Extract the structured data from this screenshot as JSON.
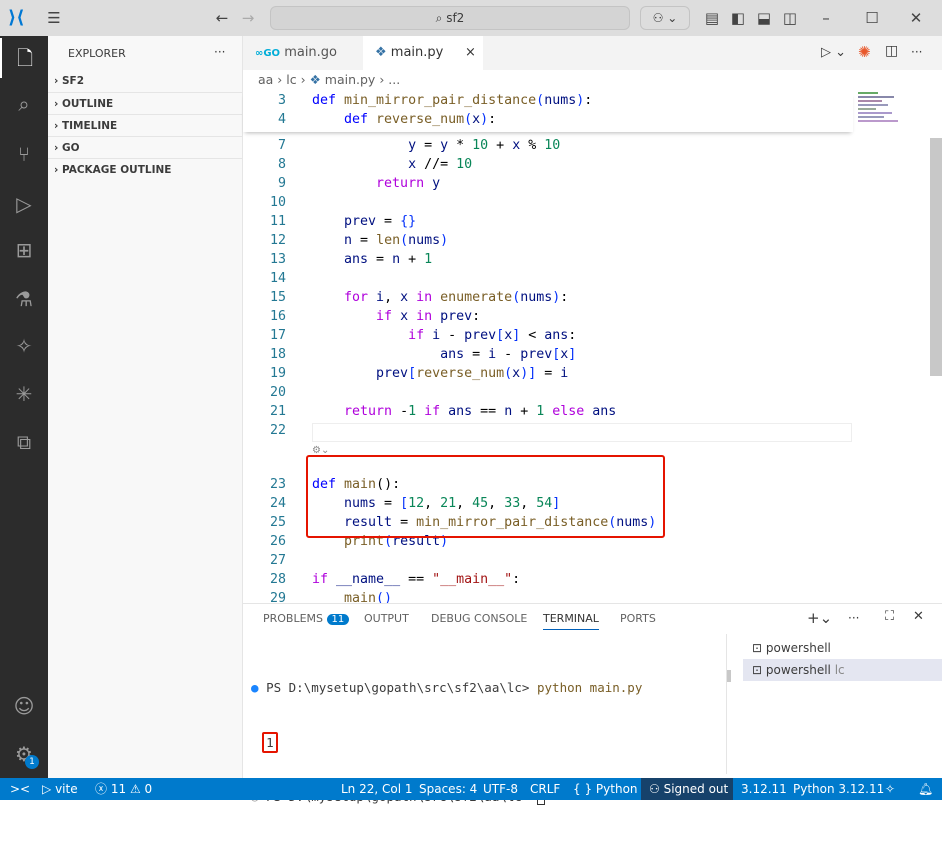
{
  "titlebar": {
    "search": "sf2",
    "back": "←",
    "forward": "→"
  },
  "activity": [
    "files-icon",
    "search-icon",
    "source-control-icon",
    "run-debug-icon",
    "extensions-icon",
    "testing-icon",
    "remote-icon",
    "copilot-icon",
    "remote-explorer-icon"
  ],
  "sidebar": {
    "title": "EXPLORER",
    "more": "···",
    "sections": [
      "SF2",
      "OUTLINE",
      "TIMELINE",
      "GO",
      "PACKAGE OUTLINE"
    ]
  },
  "tabs": [
    {
      "label": "main.go",
      "icon": "GO",
      "active": false
    },
    {
      "label": "main.py",
      "active": true,
      "close": "×"
    }
  ],
  "breadcrumb": [
    "aa",
    "lc",
    "main.py",
    "..."
  ],
  "sticky": [
    {
      "n": "3",
      "t": [
        [
          "def ",
          "k"
        ],
        [
          "min_mirror_pair_distance",
          "f"
        ],
        [
          "(",
          "b"
        ],
        [
          "nums",
          "v"
        ],
        [
          ")",
          "b"
        ],
        [
          ":",
          "p"
        ]
      ]
    },
    {
      "n": "4",
      "t": [
        [
          "    def ",
          "k"
        ],
        [
          "reverse_num",
          "f"
        ],
        [
          "(",
          "b"
        ],
        [
          "x",
          "v"
        ],
        [
          ")",
          "b"
        ],
        [
          ":",
          "p"
        ]
      ]
    }
  ],
  "lines": [
    {
      "n": "7",
      "t": [
        [
          "            y",
          "v"
        ],
        [
          " = ",
          "p"
        ],
        [
          "y",
          "v"
        ],
        [
          " * ",
          "p"
        ],
        [
          "10",
          "n"
        ],
        [
          " + ",
          "p"
        ],
        [
          "x",
          "v"
        ],
        [
          " % ",
          "p"
        ],
        [
          "10",
          "n"
        ]
      ]
    },
    {
      "n": "8",
      "t": [
        [
          "            x",
          "v"
        ],
        [
          " //= ",
          "p"
        ],
        [
          "10",
          "n"
        ]
      ]
    },
    {
      "n": "9",
      "t": [
        [
          "        return ",
          "c"
        ],
        [
          "y",
          "v"
        ]
      ]
    },
    {
      "n": "10",
      "t": []
    },
    {
      "n": "11",
      "t": [
        [
          "    prev",
          "v"
        ],
        [
          " = ",
          "p"
        ],
        [
          "{}",
          "b"
        ]
      ]
    },
    {
      "n": "12",
      "t": [
        [
          "    n",
          "v"
        ],
        [
          " = ",
          "p"
        ],
        [
          "len",
          "f"
        ],
        [
          "(",
          "b"
        ],
        [
          "nums",
          "v"
        ],
        [
          ")",
          "b"
        ]
      ]
    },
    {
      "n": "13",
      "t": [
        [
          "    ans",
          "v"
        ],
        [
          " = ",
          "p"
        ],
        [
          "n",
          "v"
        ],
        [
          " + ",
          "p"
        ],
        [
          "1",
          "n"
        ]
      ]
    },
    {
      "n": "14",
      "t": []
    },
    {
      "n": "15",
      "t": [
        [
          "    for ",
          "c"
        ],
        [
          "i",
          "v"
        ],
        [
          ", ",
          "p"
        ],
        [
          "x",
          "v"
        ],
        [
          " in ",
          "c"
        ],
        [
          "enumerate",
          "f"
        ],
        [
          "(",
          "b"
        ],
        [
          "nums",
          "v"
        ],
        [
          ")",
          "b"
        ],
        [
          ":",
          "p"
        ]
      ]
    },
    {
      "n": "16",
      "t": [
        [
          "        if ",
          "c"
        ],
        [
          "x",
          "v"
        ],
        [
          " in ",
          "c"
        ],
        [
          "prev",
          "v"
        ],
        [
          ":",
          "p"
        ]
      ]
    },
    {
      "n": "17",
      "t": [
        [
          "            if ",
          "c"
        ],
        [
          "i",
          "v"
        ],
        [
          " - ",
          "p"
        ],
        [
          "prev",
          "v"
        ],
        [
          "[",
          "b"
        ],
        [
          "x",
          "v"
        ],
        [
          "]",
          "b"
        ],
        [
          " < ",
          "p"
        ],
        [
          "ans",
          "v"
        ],
        [
          ":",
          "p"
        ]
      ]
    },
    {
      "n": "18",
      "t": [
        [
          "                ans",
          "v"
        ],
        [
          " = ",
          "p"
        ],
        [
          "i",
          "v"
        ],
        [
          " - ",
          "p"
        ],
        [
          "prev",
          "v"
        ],
        [
          "[",
          "b"
        ],
        [
          "x",
          "v"
        ],
        [
          "]",
          "b"
        ]
      ]
    },
    {
      "n": "19",
      "t": [
        [
          "        prev",
          "v"
        ],
        [
          "[",
          "b"
        ],
        [
          "reverse_num",
          "f"
        ],
        [
          "(",
          "b"
        ],
        [
          "x",
          "v"
        ],
        [
          ")",
          "b"
        ],
        [
          "]",
          "b"
        ],
        [
          " = ",
          "p"
        ],
        [
          "i",
          "v"
        ]
      ]
    },
    {
      "n": "20",
      "t": []
    },
    {
      "n": "21",
      "t": [
        [
          "    return ",
          "c"
        ],
        [
          "-",
          "p"
        ],
        [
          "1",
          "n"
        ],
        [
          " if ",
          "c"
        ],
        [
          "ans",
          "v"
        ],
        [
          " == ",
          "p"
        ],
        [
          "n",
          "v"
        ],
        [
          " + ",
          "p"
        ],
        [
          "1",
          "n"
        ],
        [
          " else ",
          "c"
        ],
        [
          "ans",
          "v"
        ]
      ]
    },
    {
      "n": "22",
      "t": []
    },
    {
      "n": "",
      "t": []
    },
    {
      "n": "23",
      "t": [
        [
          "def ",
          "k"
        ],
        [
          "main",
          "f"
        ],
        [
          "():",
          "p"
        ]
      ]
    },
    {
      "n": "24",
      "t": [
        [
          "    nums",
          "v"
        ],
        [
          " = ",
          "p"
        ],
        [
          "[",
          "b"
        ],
        [
          "12",
          "n"
        ],
        [
          ", ",
          "p"
        ],
        [
          "21",
          "n"
        ],
        [
          ", ",
          "p"
        ],
        [
          "45",
          "n"
        ],
        [
          ", ",
          "p"
        ],
        [
          "33",
          "n"
        ],
        [
          ", ",
          "p"
        ],
        [
          "54",
          "n"
        ],
        [
          "]",
          "b"
        ]
      ]
    },
    {
      "n": "25",
      "t": [
        [
          "    result",
          "v"
        ],
        [
          " = ",
          "p"
        ],
        [
          "min_mirror_pair_distance",
          "f"
        ],
        [
          "(",
          "b"
        ],
        [
          "nums",
          "v"
        ],
        [
          ")",
          "b"
        ]
      ]
    },
    {
      "n": "26",
      "t": [
        [
          "    print",
          "f"
        ],
        [
          "(",
          "b"
        ],
        [
          "result",
          "v"
        ],
        [
          ")",
          "b"
        ]
      ]
    },
    {
      "n": "27",
      "t": []
    },
    {
      "n": "28",
      "t": [
        [
          "if ",
          "c"
        ],
        [
          "__name__",
          "v"
        ],
        [
          " == ",
          "p"
        ],
        [
          "\"__main__\"",
          "s"
        ],
        [
          ":",
          "p"
        ]
      ]
    },
    {
      "n": "29",
      "t": [
        [
          "    main",
          "f"
        ],
        [
          "()",
          "b"
        ]
      ]
    }
  ],
  "panel": {
    "tabs": [
      "PROBLEMS",
      "OUTPUT",
      "DEBUG CONSOLE",
      "TERMINAL",
      "PORTS"
    ],
    "problems_count": "11",
    "active": "TERMINAL",
    "terminal": [
      {
        "prompt": "PS D:\\mysetup\\gopath\\src\\sf2\\aa\\lc> ",
        "cmd": "python main.py"
      },
      {
        "out": "1"
      },
      {
        "prompt": "PS D:\\mysetup\\gopath\\src\\sf2\\aa\\lc> ",
        "cmd": ""
      }
    ],
    "sessions": [
      {
        "label": "powershell",
        "sub": ""
      },
      {
        "label": "powershell",
        "sub": "lc"
      }
    ]
  },
  "status": {
    "remote": "><",
    "run": "vite",
    "errors": "11",
    "warnings": "0",
    "position": "Ln 22, Col 1",
    "spaces": "Spaces: 4",
    "encoding": "UTF-8",
    "eol": "CRLF",
    "language": "Python",
    "braces": "{ }",
    "signed": "Signed out",
    "version": "3.12.11",
    "interpreter": "Python 3.12.11"
  },
  "colors": {
    "accent": "#007acc",
    "highlight": "#e51400"
  }
}
